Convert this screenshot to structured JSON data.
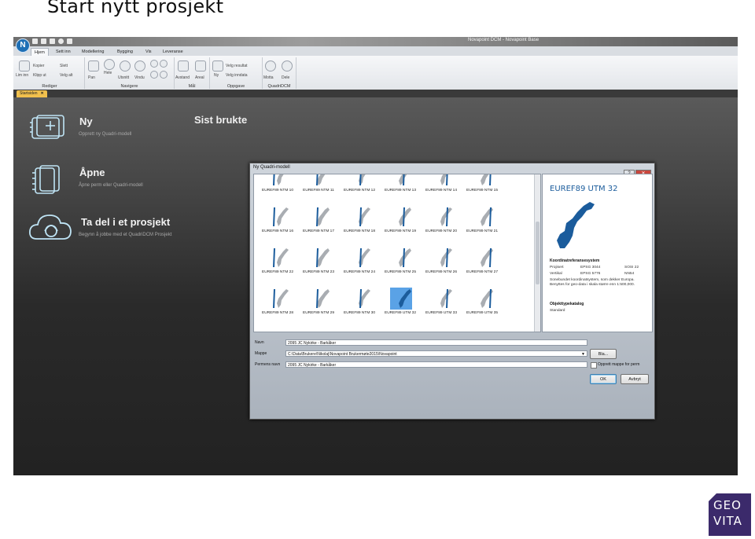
{
  "slide_title": "Start nytt prosjekt",
  "window": {
    "title": "Novapoint DCM - Novapoint Base",
    "logo_letter": "N"
  },
  "ribbon_tabs": [
    "Hjem",
    "Sett inn",
    "Modellering",
    "Bygging",
    "Vis",
    "Leveranse"
  ],
  "ribbon_groups": {
    "rediger": {
      "label": "Rediger",
      "buttons": [
        "Lim inn",
        "Kopier",
        "Klipp ut",
        "Slett",
        "Velg alt"
      ]
    },
    "navigere": {
      "label": "Navigere",
      "buttons": [
        "Pan",
        "Hele",
        "Utsnitt",
        "Vindu"
      ]
    },
    "maal": {
      "label": "Mål",
      "buttons": [
        "Avstand",
        "Areal"
      ]
    },
    "oppgave": {
      "label": "Oppgave",
      "buttons": [
        "Ny",
        "Velg resultat",
        "Velg inndata"
      ]
    },
    "quadri": {
      "label": "QuadriDCM",
      "buttons": [
        "Motta",
        "Dele"
      ]
    }
  },
  "doc_tab": {
    "label": "Startsiden",
    "close": "✕"
  },
  "start": {
    "ny": {
      "title": "Ny",
      "subtitle": "Opprett ny Quadri-modell"
    },
    "apne": {
      "title": "Åpne",
      "subtitle": "Åpne perm eller Quadri-modell"
    },
    "ta_del": {
      "title": "Ta del i et prosjekt",
      "subtitle": "Begynn å jobbe med et QuadriDCM Prosjekt"
    },
    "sist_brukte": "Sist brukte"
  },
  "dialog": {
    "title": "Ny Quadri-modell",
    "window_buttons": [
      "?",
      "✕"
    ],
    "projections": [
      "EUREF89 NTM 10",
      "EUREF89 NTM 11",
      "EUREF89 NTM 12",
      "EUREF89 NTM 13",
      "EUREF89 NTM 14",
      "EUREF89 NTM 15",
      "EUREF89 NTM 16",
      "EUREF89 NTM 17",
      "EUREF89 NTM 18",
      "EUREF89 NTM 19",
      "EUREF89 NTM 20",
      "EUREF89 NTM 21",
      "EUREF89 NTM 22",
      "EUREF89 NTM 23",
      "EUREF89 NTM 24",
      "EUREF89 NTM 25",
      "EUREF89 NTM 26",
      "EUREF89 NTM 27",
      "EUREF89 NTM 28",
      "EUREF89 NTM 29",
      "EUREF89 NTM 30",
      "EUREF89 UTM 32",
      "EUREF89 UTM 33",
      "EUREF89 UTM 35"
    ],
    "selected_projection": "EUREF89 UTM 32",
    "info": {
      "title": "EUREF89 UTM 32",
      "crs_heading": "Koordinatreferansesystem",
      "projisert_label": "Projisert",
      "projisert_code": "EPSG 3044",
      "projisert_sosi": "SOSI 22",
      "vertikal_label": "Vertikal",
      "vertikal_code": "EPSG 5776",
      "vertikal_name": "NN54",
      "description": "Sonebundet koordinatsystem, som dekker Europa. Benyttes for geo-data i skala større enn 1:500,000.",
      "catalog_heading": "Objekttypekatalog",
      "catalog_value": "Standard"
    },
    "form": {
      "navn_label": "Navn",
      "navn_value": "2095 JC Nykirke - Barkåker",
      "mappe_label": "Mappe",
      "mappe_value": "C:\\Data\\Brukere\\Nikolaj\\Novapoint Brukermøte2015\\Novapoint",
      "browse_label": "Bla...",
      "permens_label": "Permens navn",
      "permens_value": "2095 JC Nykirke - Barkåker",
      "checkbox_label": "Opprett mappe for perm",
      "ok_label": "OK",
      "cancel_label": "Avbryt"
    }
  },
  "brand": {
    "line1": "GEO",
    "line2": "VITA"
  },
  "colors": {
    "accent": "#1e6fb5",
    "selected": "#5aa2e6",
    "doc_tab": "#f1c04d",
    "brand": "#3b2a6b"
  }
}
